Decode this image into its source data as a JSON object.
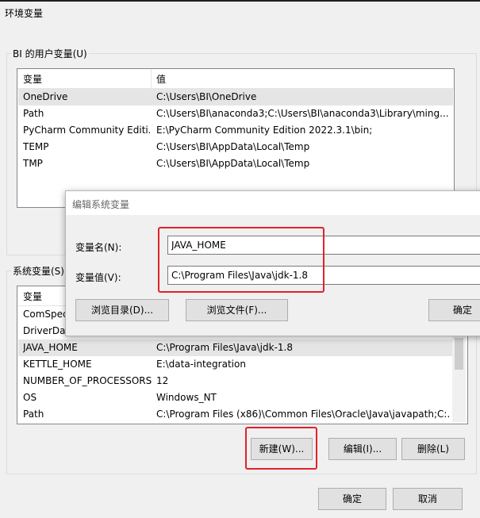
{
  "window": {
    "title": "环境变量"
  },
  "user_vars": {
    "group_label": "BI 的用户变量(U)",
    "col_name": "变量",
    "col_value": "值",
    "rows": [
      {
        "name": "OneDrive",
        "value": "C:\\Users\\BI\\OneDrive"
      },
      {
        "name": "Path",
        "value": "C:\\Users\\BI\\anaconda3;C:\\Users\\BI\\anaconda3\\Library\\ming..."
      },
      {
        "name": "PyCharm Community Editi...",
        "value": "E:\\PyCharm Community Edition 2022.3.1\\bin;"
      },
      {
        "name": "TEMP",
        "value": "C:\\Users\\BI\\AppData\\Local\\Temp"
      },
      {
        "name": "TMP",
        "value": "C:\\Users\\BI\\AppData\\Local\\Temp"
      }
    ]
  },
  "sys_vars": {
    "group_label": "系统变量(S)",
    "col_name": "变量",
    "rows": [
      {
        "name": "ComSpec",
        "value": ""
      },
      {
        "name": "DriverData",
        "value": ""
      },
      {
        "name": "JAVA_HOME",
        "value": "C:\\Program Files\\Java\\jdk-1.8"
      },
      {
        "name": "KETTLE_HOME",
        "value": "E:\\data-integration"
      },
      {
        "name": "NUMBER_OF_PROCESSORS",
        "value": "12"
      },
      {
        "name": "OS",
        "value": "Windows_NT"
      },
      {
        "name": "Path",
        "value": "C:\\Program Files (x86)\\Common Files\\Oracle\\Java\\javapath;C:..."
      }
    ],
    "buttons": {
      "new": "新建(W)...",
      "edit": "编辑(I)...",
      "delete": "删除(L)"
    }
  },
  "footer": {
    "ok": "确定",
    "cancel": "取消"
  },
  "dialog": {
    "title": "编辑系统变量",
    "name_label": "变量名(N):",
    "name_value": "JAVA_HOME",
    "value_label": "变量值(V):",
    "value_value": "C:\\Program Files\\Java\\jdk-1.8",
    "browse_dir": "浏览目录(D)...",
    "browse_file": "浏览文件(F)...",
    "ok": "确定"
  },
  "colors": {
    "highlight": "#e0222c",
    "selection": "#e5e5e5"
  }
}
